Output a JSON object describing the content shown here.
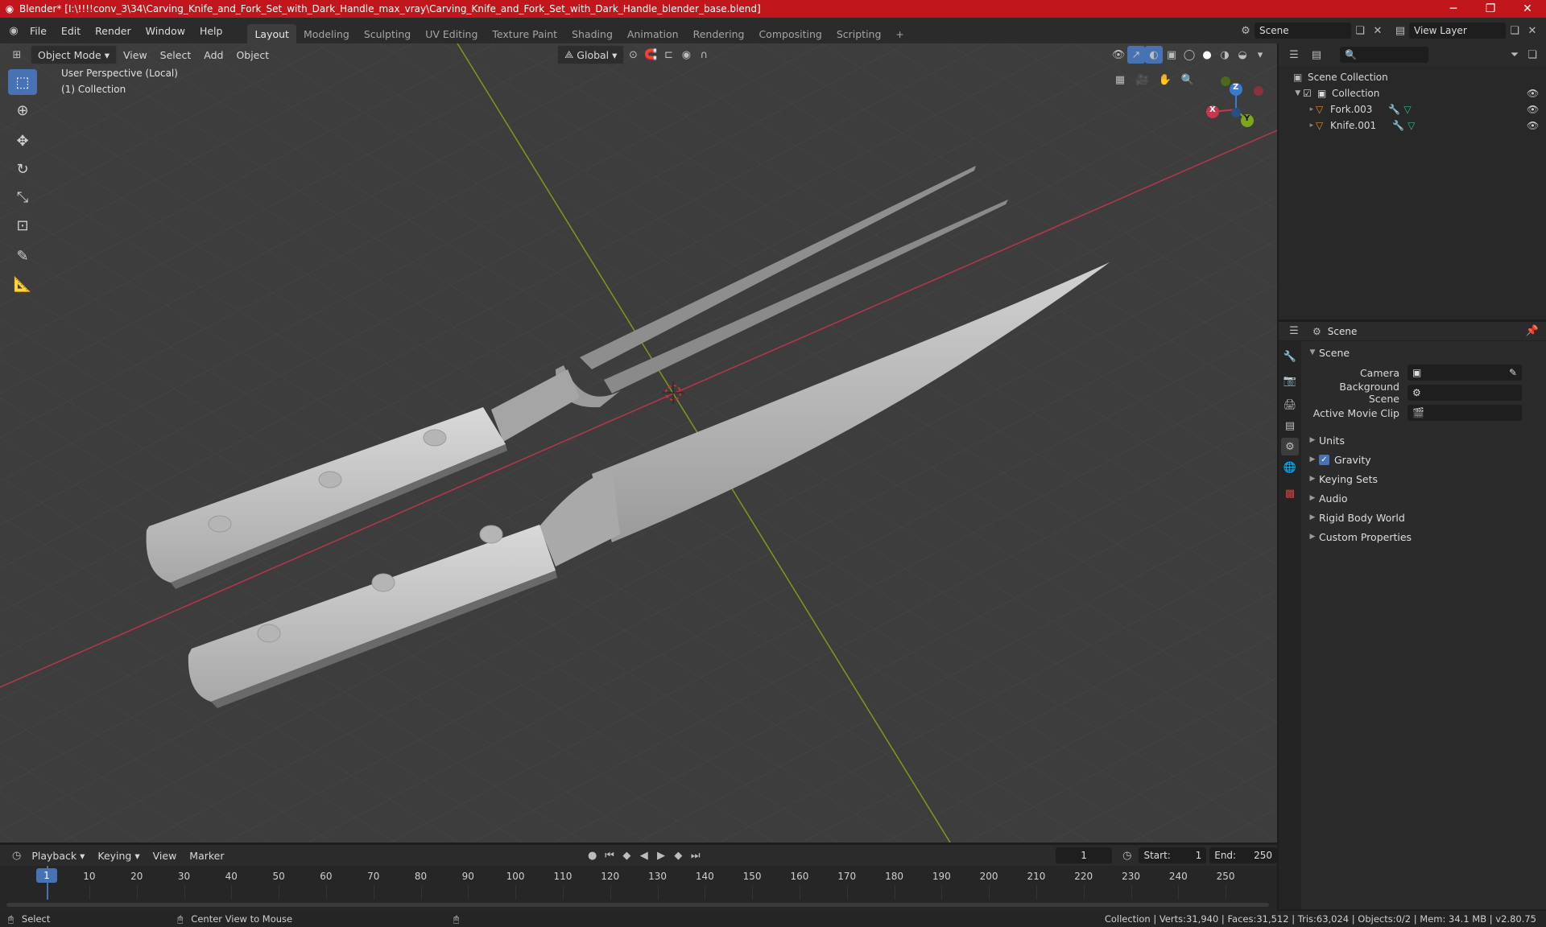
{
  "titlebar": {
    "title": "Blender* [I:\\!!!!conv_3\\34\\Carving_Knife_and_Fork_Set_with_Dark_Handle_max_vray\\Carving_Knife_and_Fork_Set_with_Dark_Handle_blender_base.blend]",
    "minimize": "─",
    "maximize": "❐",
    "close": "✕"
  },
  "menu": [
    "File",
    "Edit",
    "Render",
    "Window",
    "Help"
  ],
  "workspaces": [
    "Layout",
    "Modeling",
    "Sculpting",
    "UV Editing",
    "Texture Paint",
    "Shading",
    "Animation",
    "Rendering",
    "Compositing",
    "Scripting",
    "+"
  ],
  "scene_selector": "Scene",
  "view_layer_selector": "View Layer",
  "viewport_header": {
    "mode": "Object Mode",
    "menus": [
      "View",
      "Select",
      "Add",
      "Object"
    ],
    "transform": "Global"
  },
  "viewport_overlay": {
    "perspective": "User Perspective (Local)",
    "collection": "(1) Collection"
  },
  "gizmo": {
    "x": "X",
    "y": "Y",
    "z": "Z"
  },
  "outliner": {
    "root": "Scene Collection",
    "collection": "Collection",
    "objects": [
      "Fork.003",
      "Knife.001"
    ]
  },
  "properties": {
    "context": "Scene",
    "panel": "Scene",
    "camera_label": "Camera",
    "background_label": "Background Scene",
    "movieclip_label": "Active Movie Clip",
    "sections": [
      "Units",
      "Gravity",
      "Keying Sets",
      "Audio",
      "Rigid Body World",
      "Custom Properties"
    ],
    "gravity_checked": true
  },
  "timeline": {
    "menus": [
      "Playback",
      "Keying",
      "View",
      "Marker"
    ],
    "current_frame": "1",
    "start_label": "Start:",
    "start": "1",
    "end_label": "End:",
    "end": "250",
    "ticks": [
      "1",
      "10",
      "20",
      "30",
      "40",
      "50",
      "60",
      "70",
      "80",
      "90",
      "100",
      "110",
      "120",
      "130",
      "140",
      "150",
      "160",
      "170",
      "180",
      "190",
      "200",
      "210",
      "220",
      "230",
      "240",
      "250"
    ]
  },
  "statusbar": {
    "select": "Select",
    "center": "Center View to Mouse",
    "stats": "Collection | Verts:31,940 | Faces:31,512 | Tris:63,024 | Objects:0/2 | Mem: 34.1 MB | v2.80.75"
  },
  "colors": {
    "accent": "#4772b3",
    "titlebar": "#c0161c",
    "x_axis": "#c9354a",
    "y_axis": "#7ea61a"
  }
}
